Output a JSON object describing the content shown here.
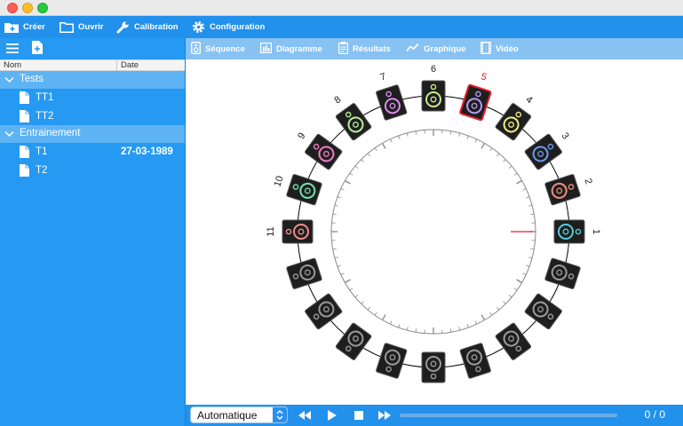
{
  "toolbar": {
    "create_label": "Créer",
    "open_label": "Ouvrir",
    "calibration_label": "Calibration",
    "configuration_label": "Configuration"
  },
  "sidebar": {
    "columns": {
      "name": "Nom",
      "date": "Date"
    },
    "groups": [
      {
        "label": "Tests",
        "items": [
          {
            "label": "TT1",
            "date": ""
          },
          {
            "label": "TT2",
            "date": ""
          }
        ]
      },
      {
        "label": "Entrainement",
        "items": [
          {
            "label": "T1",
            "date": "27-03-1989"
          },
          {
            "label": "T2",
            "date": ""
          }
        ]
      }
    ]
  },
  "tabs": {
    "sequence": "Séquence",
    "diagram": "Diagramme",
    "results": "Résultats",
    "chart": "Graphique",
    "video": "Vidéo"
  },
  "speakers": [
    {
      "label": "1",
      "color": "#4fd0d8",
      "active": true
    },
    {
      "label": "2",
      "color": "#f0907a",
      "active": true
    },
    {
      "label": "3",
      "color": "#6a9cf0",
      "active": true
    },
    {
      "label": "4",
      "color": "#ecec80",
      "active": true
    },
    {
      "label": "5",
      "color": "#b39cf0",
      "active": true,
      "selected": true
    },
    {
      "label": "6",
      "color": "#c8ec8a",
      "active": true
    },
    {
      "label": "7",
      "color": "#e08cf0",
      "active": true
    },
    {
      "label": "8",
      "color": "#b9ec96",
      "active": true
    },
    {
      "label": "9",
      "color": "#f07cc8",
      "active": true
    },
    {
      "label": "10",
      "color": "#74e2b4",
      "active": true
    },
    {
      "label": "11",
      "color": "#f08c8c",
      "active": true
    },
    {
      "label": "",
      "color": "#9a9a9a",
      "active": false
    },
    {
      "label": "",
      "color": "#9a9a9a",
      "active": false
    },
    {
      "label": "",
      "color": "#9a9a9a",
      "active": false
    },
    {
      "label": "",
      "color": "#9a9a9a",
      "active": false
    },
    {
      "label": "",
      "color": "#9a9a9a",
      "active": false
    },
    {
      "label": "",
      "color": "#9a9a9a",
      "active": false
    },
    {
      "label": "",
      "color": "#9a9a9a",
      "active": false
    },
    {
      "label": "",
      "color": "#9a9a9a",
      "active": false
    },
    {
      "label": "",
      "color": "#9a9a9a",
      "active": false
    }
  ],
  "selected_color": "#e8202a",
  "playback": {
    "mode": "Automatique",
    "counter": "0 / 0",
    "progress": 0
  },
  "colors": {
    "toolbar": "#2291ec",
    "sidebar": "#2699f3",
    "group": "#5eb3f5",
    "tabbar": "#88c2f3"
  }
}
